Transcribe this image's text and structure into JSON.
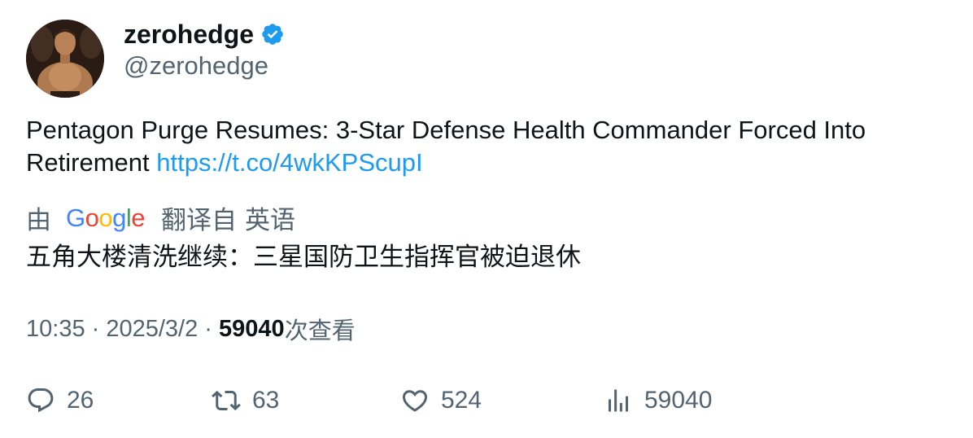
{
  "author": {
    "display_name": "zerohedge",
    "handle": "@zerohedge",
    "verified": true,
    "verified_color": "#1d9bf0"
  },
  "tweet": {
    "text": "Pentagon Purge Resumes: 3-Star Defense Health Commander Forced Into Retirement ",
    "link": "https://t.co/4wkKPScupI",
    "link_color": "#1d9bf0"
  },
  "translation": {
    "by_label": "由",
    "google_letters": [
      "G",
      "o",
      "o",
      "g",
      "l",
      "e"
    ],
    "from_label": "翻译自",
    "language": "英语",
    "translated_text": "五角大楼清洗继续：三星国防卫生指挥官被迫退休"
  },
  "meta": {
    "time": "10:35",
    "separator": " · ",
    "date": "2025/3/2",
    "views_count": "59040",
    "views_suffix": "次查看"
  },
  "actions": {
    "reply": {
      "icon": "reply-icon",
      "count": "26"
    },
    "retweet": {
      "icon": "retweet-icon",
      "count": "63"
    },
    "like": {
      "icon": "like-icon",
      "count": "524"
    },
    "views": {
      "icon": "views-icon",
      "count": "59040"
    }
  },
  "colors": {
    "text_primary": "#0f1419",
    "text_secondary": "#536471",
    "accent": "#1d9bf0"
  }
}
